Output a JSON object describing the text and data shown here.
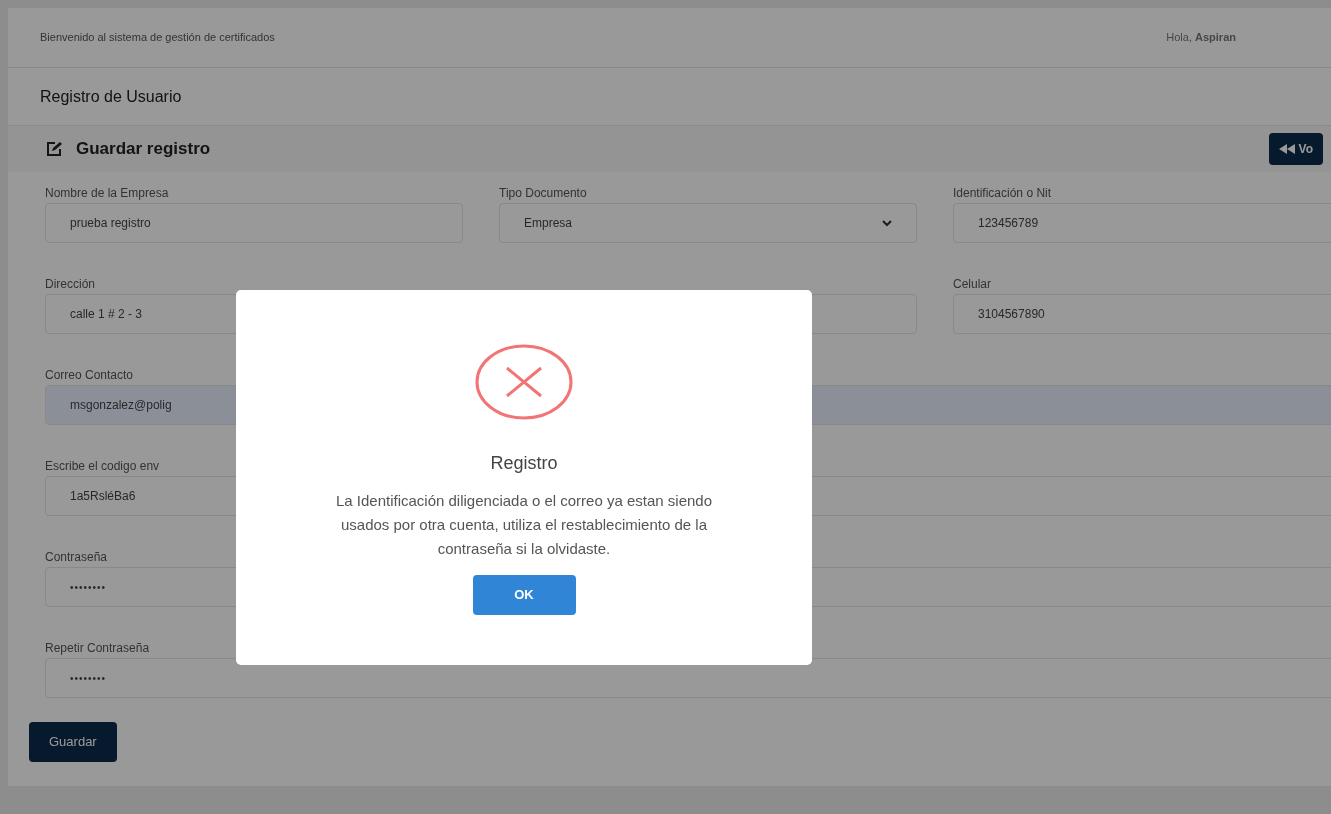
{
  "header": {
    "welcome": "Bienvenido al sistema de gestión de certificados",
    "greeting": "Hola, **Aspiran**"
  },
  "page_title": "Registro de Usuario",
  "card": {
    "title": "Guardar registro",
    "back_button": "Vo"
  },
  "rows": [
    [
      {
        "label": "Nombre de la Empresa",
        "value": "prueba registro",
        "kind": "text",
        "autofilled": false
      },
      {
        "label": "Tipo Documento",
        "value": "Empresa",
        "kind": "select",
        "autofilled": false
      },
      {
        "label": "Identificación o Nit",
        "value": "123456789",
        "kind": "text",
        "autofilled": false
      }
    ],
    [
      {
        "label": "Dirección",
        "value": "calle 1 # 2 - 3",
        "kind": "text",
        "autofilled": false
      },
      {
        "kind": "text",
        "autofilled": false
      },
      {
        "label": "Celular",
        "value": "3104567890",
        "kind": "text",
        "autofilled": false
      }
    ],
    [
      {
        "label": "Correo Contacto",
        "value": "msgonzalez@polig",
        "kind": "text",
        "autofilled": true
      }
    ],
    [
      {
        "label": "Escribe el codigo env",
        "value": "1a5RsléBa6",
        "kind": "text",
        "autofilled": false
      }
    ],
    [
      {
        "label": "Contraseña",
        "value": "••••••••",
        "kind": "password",
        "autofilled": false
      }
    ],
    [
      {
        "label": "Repetir Contraseña",
        "value": "••••••••",
        "kind": "password",
        "autofilled": false
      }
    ]
  ],
  "submit_button": "Guardar",
  "dialog": {
    "title": "Registro",
    "message": "La Identificación diligenciada o el correo ya estan siendo usados por otra cuenta, utiliza el restablecimiento de la contraseña si la olvidaste.",
    "button": "OK"
  }
}
